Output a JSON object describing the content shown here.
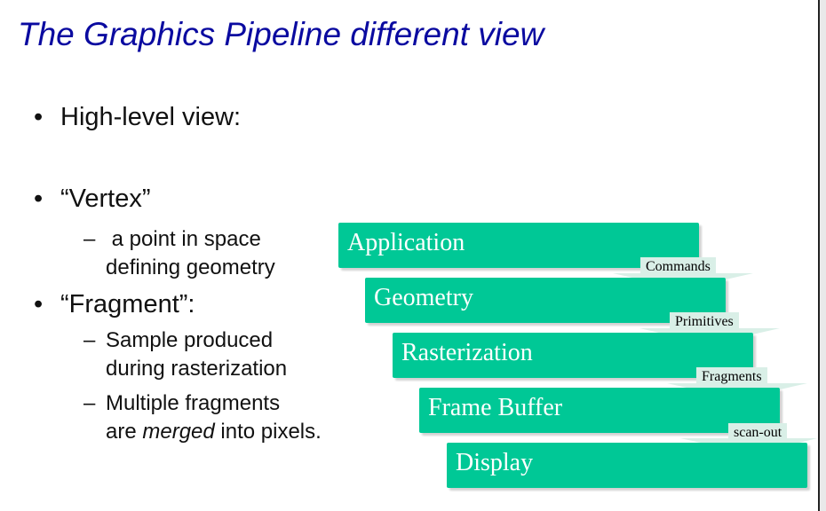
{
  "slide": {
    "title": "The Graphics Pipeline different view",
    "bullets": [
      {
        "marker": "•",
        "text": "High-level view:"
      },
      {
        "marker": "•",
        "text": "“Vertex”"
      },
      {
        "marker": "•",
        "text": "“Fragment”:"
      }
    ],
    "vertex_sub": {
      "dash": "–",
      "line1": " a point in space",
      "line2": "defining geometry"
    },
    "fragment_subs": [
      {
        "dash": "–",
        "line1": "Sample produced",
        "line2": "during rasterization"
      },
      {
        "dash": "–",
        "line1": "Multiple fragments",
        "line2_pre": "are ",
        "line2_em": "merged",
        "line2_post": " into pixels."
      }
    ]
  },
  "pipeline": {
    "stage_color": "#00c896",
    "stages": [
      {
        "label": "Application"
      },
      {
        "label": "Geometry"
      },
      {
        "label": "Rasterization"
      },
      {
        "label": "Frame Buffer"
      },
      {
        "label": "Display"
      }
    ],
    "transitions": [
      {
        "label": "Commands"
      },
      {
        "label": "Primitives"
      },
      {
        "label": "Fragments"
      },
      {
        "label": "scan-out"
      }
    ]
  }
}
